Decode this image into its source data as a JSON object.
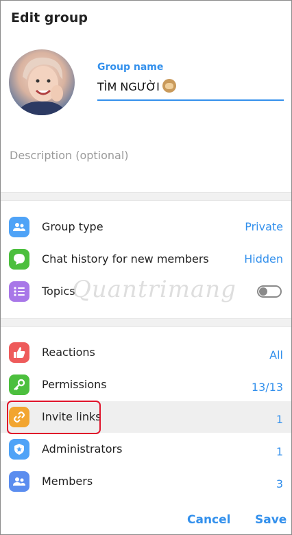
{
  "dialog": {
    "title": "Edit group"
  },
  "group_name": {
    "label": "Group name",
    "value": "TÌM NGƯỜI"
  },
  "description": {
    "placeholder": "Description (optional)"
  },
  "settings": [
    {
      "label": "Group type",
      "value": "Private",
      "icon": "group-icon",
      "color": "#4fa3f7"
    },
    {
      "label": "Chat history for new members",
      "value": "Hidden",
      "icon": "chat-bubble-icon",
      "color": "#4cbf3e"
    },
    {
      "label": "Topics",
      "value": "",
      "icon": "list-icon",
      "color": "#a877e8",
      "toggle": false
    }
  ],
  "manage": [
    {
      "label": "Reactions",
      "value": "All",
      "icon": "thumbs-up-icon",
      "color": "#ee5b5b"
    },
    {
      "label": "Permissions",
      "value": "13/13",
      "icon": "key-icon",
      "color": "#4cbf3e"
    },
    {
      "label": "Invite links",
      "value": "1",
      "icon": "link-icon",
      "color": "#f2a530"
    },
    {
      "label": "Administrators",
      "value": "1",
      "icon": "shield-icon",
      "color": "#4fa3f7"
    },
    {
      "label": "Members",
      "value": "3",
      "icon": "group-icon",
      "color": "#5b8def"
    }
  ],
  "watermark": "Quantrimang",
  "buttons": {
    "cancel": "Cancel",
    "save": "Save"
  }
}
